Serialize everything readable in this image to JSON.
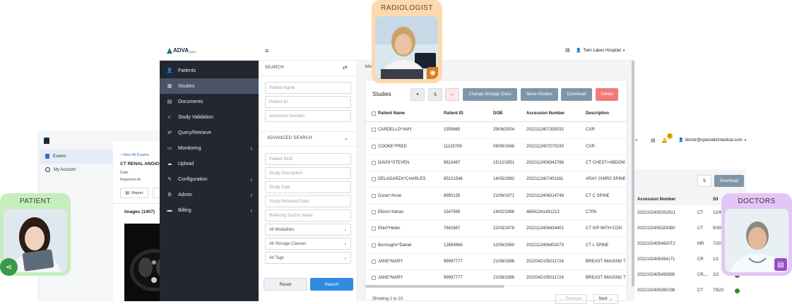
{
  "patient_portal": {
    "nav": [
      {
        "label": "Exams",
        "icon": "exams-icon"
      },
      {
        "label": "My Account",
        "icon": "account-icon"
      }
    ],
    "back_link": "View All Exams",
    "exam_title": "CT RENAL ANGIOG",
    "date_label": "Date",
    "reported_label": "Reported At",
    "report_button": "Report",
    "images_label": "Images (1407)"
  },
  "doctors_portal": {
    "hospital_fragment": "a",
    "notif_count": "0",
    "user_email": "doctor@specialistmedical.com",
    "download_button": "Download",
    "columns": [
      "Accession Number",
      "S/I"
    ],
    "rows": [
      {
        "accession": "20221024053S2921",
        "modality": "CT",
        "si": "12/4"
      },
      {
        "accession": "20221024053Z4390",
        "modality": "CT",
        "si": "9/39"
      },
      {
        "accession": "20221024054620T2",
        "modality": "MR",
        "si": "7/20"
      },
      {
        "accession": "2022102405454171",
        "modality": "CR",
        "si": "1/1"
      },
      {
        "accession": "2022102405450895",
        "modality": "CR,...",
        "si": "2/2"
      },
      {
        "accession": "2022102405360198",
        "modality": "CT",
        "si": "7/523"
      }
    ]
  },
  "app": {
    "logo_text": "ADVA",
    "logo_suffix": "pacs",
    "hospital": "Twin Lakes Hospital",
    "breadcrumb": "Adv",
    "sidebar": [
      {
        "label": "Patients",
        "icon": "patients-icon",
        "has_children": false,
        "active": false
      },
      {
        "label": "Studies",
        "icon": "studies-icon",
        "has_children": false,
        "active": true
      },
      {
        "label": "Documents",
        "icon": "documents-icon",
        "has_children": false,
        "active": false
      },
      {
        "label": "Study Validation",
        "icon": "check-icon",
        "has_children": false,
        "active": false
      },
      {
        "label": "Query/Retrieve",
        "icon": "retrieve-icon",
        "has_children": false,
        "active": false
      },
      {
        "label": "Monitoring",
        "icon": "monitor-icon",
        "has_children": true,
        "active": false
      },
      {
        "label": "Upload",
        "icon": "upload-icon",
        "has_children": false,
        "active": false
      },
      {
        "label": "Configuration",
        "icon": "config-icon",
        "has_children": true,
        "active": false
      },
      {
        "label": "Admin",
        "icon": "admin-icon",
        "has_children": true,
        "active": false
      },
      {
        "label": "Billing",
        "icon": "billing-icon",
        "has_children": true,
        "active": false
      }
    ],
    "search": {
      "heading": "SEARCH",
      "placeholders": [
        "Patient Name",
        "Patient ID",
        "Accession Number"
      ],
      "advanced_heading": "ADVANCED SEARCH",
      "advanced_placeholders": [
        "Patient DOB",
        "Study Description",
        "Study Date",
        "Study Received Date",
        "Referring Doctor Name"
      ],
      "selects": [
        "All Modalities",
        "All Storage Classes",
        "All Tags"
      ],
      "reset_button": "Reset",
      "search_button": "Search"
    },
    "studies": {
      "title": "Studies",
      "buttons": {
        "change_storage": "Change Storage Class",
        "move": "Move Studies",
        "download": "Download",
        "delete": "Delete"
      },
      "columns": [
        "Patient Name",
        "Patient ID",
        "DOB",
        "Accession Number",
        "Description"
      ],
      "rows": [
        {
          "name": "CARDELLO^AMY",
          "id": "1555665",
          "dob": "29/06/2004",
          "acc": "2022112407355032",
          "desc": "CXR"
        },
        {
          "name": "COOKE^FRED",
          "id": "11125789",
          "dob": "08/09/1946",
          "acc": "2022112407270193",
          "desc": "CXR"
        },
        {
          "name": "DAVIS^STEVEN",
          "id": "9813487",
          "dob": "15/12/1951",
          "acc": "2022112406342766",
          "desc": "CT CHEST+ABDOM"
        },
        {
          "name": "DELAGARZA^CHARLES",
          "id": "85221546",
          "dob": "14/05/1992",
          "acc": "2022112407401161",
          "desc": "XRAY CHIRO SPINE"
        },
        {
          "name": "Duran^Anne",
          "id": "8950135",
          "dob": "21/06/1971",
          "acc": "2022112406314749",
          "desc": "CT C SPINE"
        },
        {
          "name": "Elkins^Adrian",
          "id": "1547565",
          "dob": "14/02/1966",
          "acc": "46541341431213",
          "desc": "CTPA"
        },
        {
          "name": "Elliot^Helen",
          "id": "7841687",
          "dob": "22/03/1978",
          "acc": "2022112406434401",
          "desc": "CT IVP WITH CON"
        },
        {
          "name": "Burroughs^Daniel",
          "id": "12654866",
          "dob": "12/06/1960",
          "acc": "2022112406453273",
          "desc": "CT L SPINE"
        },
        {
          "name": "JANE^MARY",
          "id": "99997777",
          "dob": "21/08/1986",
          "acc": "2022042105011724",
          "desc": "BREAST IMAGING T"
        },
        {
          "name": "JANE^MARY",
          "id": "99997777",
          "dob": "21/08/1986",
          "acc": "2022042105011724",
          "desc": "BREAST IMAGING T"
        }
      ],
      "showing": "Showing 1 to 10",
      "prev": "Previous",
      "next": "Next"
    }
  },
  "badges": {
    "radiologist": "RADIOLOGIST",
    "patient": "PATIENT",
    "doctors": "DOCTORS"
  },
  "colors": {
    "sidebar_bg": "#232830",
    "sidebar_active": "#495466",
    "primary": "#2f8ae0",
    "gray_button": "#7f96a8",
    "delete_button": "#f07a7a",
    "radiologist_badge": "#fdd9ae",
    "patient_badge": "#c6edbd",
    "doctors_badge": "#e3c6f5"
  }
}
